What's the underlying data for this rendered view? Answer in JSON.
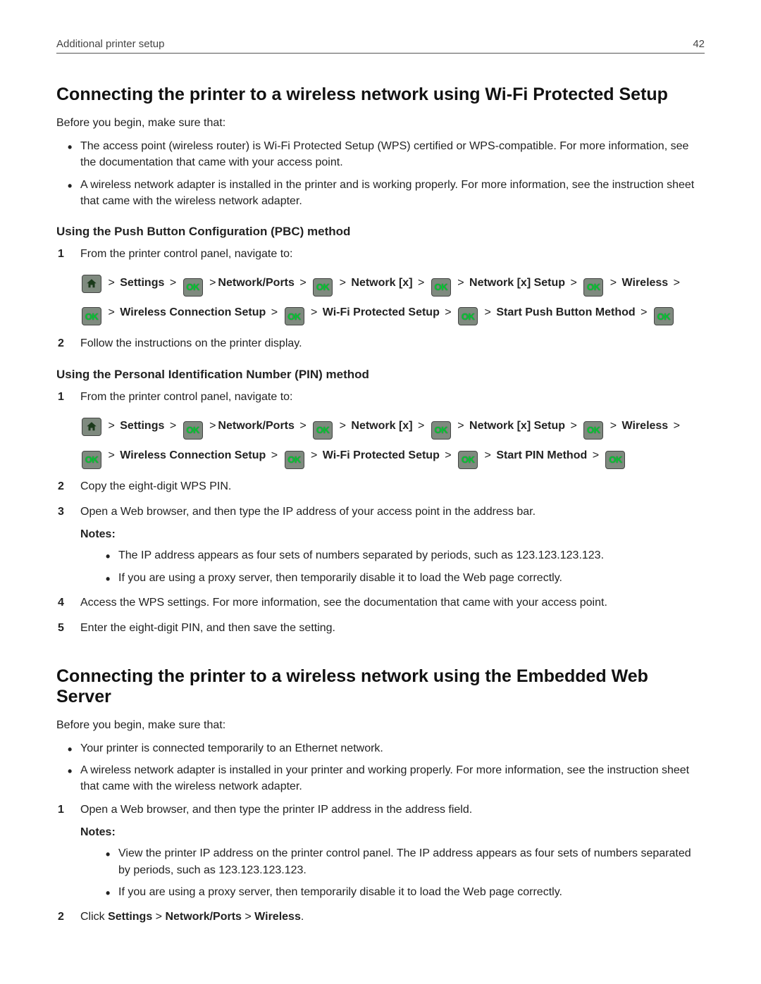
{
  "header": {
    "left": "Additional printer setup",
    "right": "42"
  },
  "sec1": {
    "title": "Connecting the printer to a wireless network using Wi‑Fi Protected Setup",
    "intro": "Before you begin, make sure that:",
    "bullets": [
      "The access point (wireless router) is Wi‑Fi Protected Setup (WPS) certified or WPS‑compatible. For more information, see the documentation that came with your access point.",
      "A wireless network adapter is installed in the printer and is working properly. For more information, see the instruction sheet that came with the wireless network adapter."
    ],
    "pbc": {
      "heading": "Using the Push Button Configuration (PBC) method",
      "step1": "From the printer control panel, navigate to:",
      "nav": {
        "settings": "Settings",
        "networkPorts": "Network/Ports",
        "networkX": "Network [x]",
        "networkXSetup": "Network [x] Setup",
        "wireless": "Wireless",
        "wirelessConnSetup": "Wireless Connection Setup",
        "wifiProtected": "Wi‑Fi Protected Setup",
        "startPush": "Start Push Button Method"
      },
      "step2": "Follow the instructions on the printer display."
    },
    "pin": {
      "heading": "Using the Personal Identification Number (PIN) method",
      "step1": "From the printer control panel, navigate to:",
      "nav": {
        "settings": "Settings",
        "networkPorts": "Network/Ports",
        "networkX": "Network [x]",
        "networkXSetup": "Network [x] Setup",
        "wireless": "Wireless",
        "wirelessConnSetup": "Wireless Connection Setup",
        "wifiProtected": "Wi‑Fi Protected Setup",
        "startPin": "Start PIN Method"
      },
      "step2": "Copy the eight‑digit WPS PIN.",
      "step3": "Open a Web browser, and then type the IP address of your access point in the address bar.",
      "notesLabel": "Notes:",
      "notes": [
        "The IP address appears as four sets of numbers separated by periods, such as 123.123.123.123.",
        "If you are using a proxy server, then temporarily disable it to load the Web page correctly."
      ],
      "step4": "Access the WPS settings. For more information, see the documentation that came with your access point.",
      "step5": "Enter the eight‑digit PIN, and then save the setting."
    }
  },
  "sec2": {
    "title": "Connecting the printer to a wireless network using the Embedded Web Server",
    "intro": "Before you begin, make sure that:",
    "bullets": [
      "Your printer is connected temporarily to an Ethernet network.",
      "A wireless network adapter is installed in your printer and working properly. For more information, see the instruction sheet that came with the wireless network adapter."
    ],
    "step1": "Open a Web browser, and then type the printer IP address in the address field.",
    "notesLabel": "Notes:",
    "notes": [
      "View the printer IP address on the printer control panel. The IP address appears as four sets of numbers separated by periods, such as 123.123.123.123.",
      "If you are using a proxy server, then temporarily disable it to load the Web page correctly."
    ],
    "step2_pre": "Click ",
    "step2_b1": "Settings",
    "step2_sep": " > ",
    "step2_b2": "Network/Ports",
    "step2_b3": "Wireless",
    "step2_post": "."
  },
  "icons": {
    "ok": "OK"
  }
}
